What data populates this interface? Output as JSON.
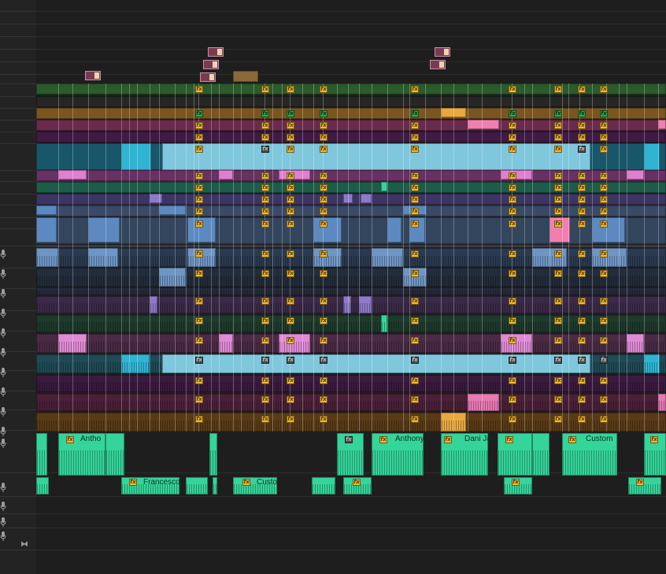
{
  "window": {
    "background": "#1d1d1d"
  },
  "header": {
    "video_track_count": 14,
    "audio_track_count": 14,
    "mic_icon": "microphone-icon",
    "zoom_icon": "fit-sequence-icon"
  },
  "clips": {
    "fx_badge": "fx",
    "audio_labels": [
      "Antho",
      "Anthony",
      "Dani Jal",
      "Custom",
      "Francesco",
      "Custo"
    ]
  },
  "colors": {
    "video_green": "#2b5a2b",
    "video_orange": "#7a5520",
    "video_magenta": "#6a2a4e",
    "video_purple": "#3e1a44",
    "video_teal": "#18566a",
    "video_cyan": "#2fb4d4",
    "video_pink": "#e07fd0",
    "video_lavender": "#8d7ac8",
    "video_blue": "#5c8ac0",
    "audio_green": "#34d49a",
    "fx_yellow": "#e8b93a",
    "fx_green": "#2ea84a"
  }
}
